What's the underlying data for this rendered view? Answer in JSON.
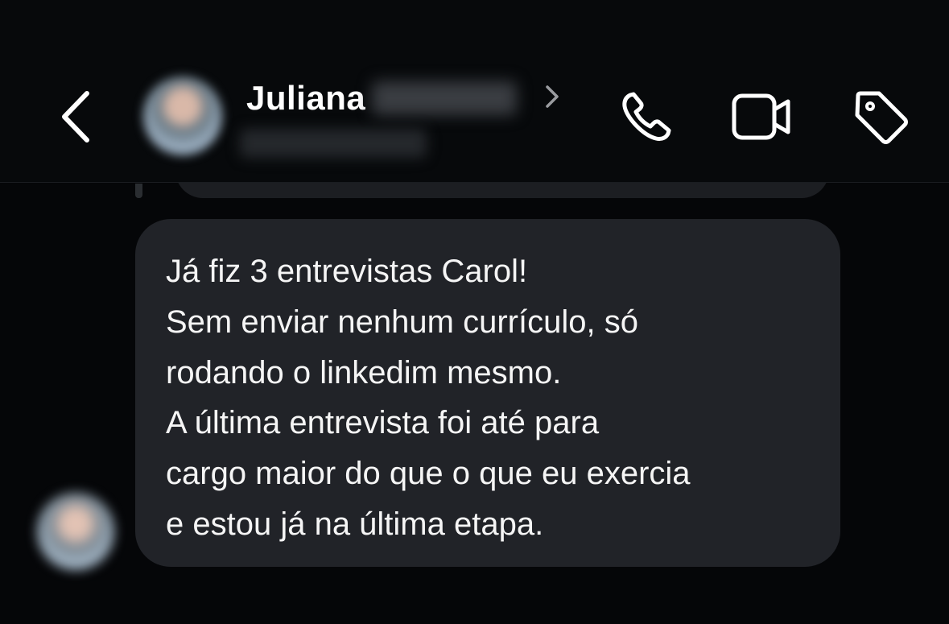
{
  "header": {
    "contact_first_name": "Juliana",
    "icons": {
      "back": "chevron-left-icon",
      "profile": "chevron-right-icon",
      "call": "phone-icon",
      "video": "video-camera-icon",
      "tag": "tag-icon"
    }
  },
  "message": {
    "lines": [
      "Já fiz 3 entrevistas Carol!",
      "Sem enviar nenhum currículo, só",
      "rodando o linkedim mesmo.",
      "A última entrevista foi até para",
      "cargo maior do que o que eu exercia",
      "e estou já na última etapa."
    ]
  },
  "colors": {
    "background": "#050608",
    "bubble": "#212328",
    "text": "#f5f5f5"
  }
}
